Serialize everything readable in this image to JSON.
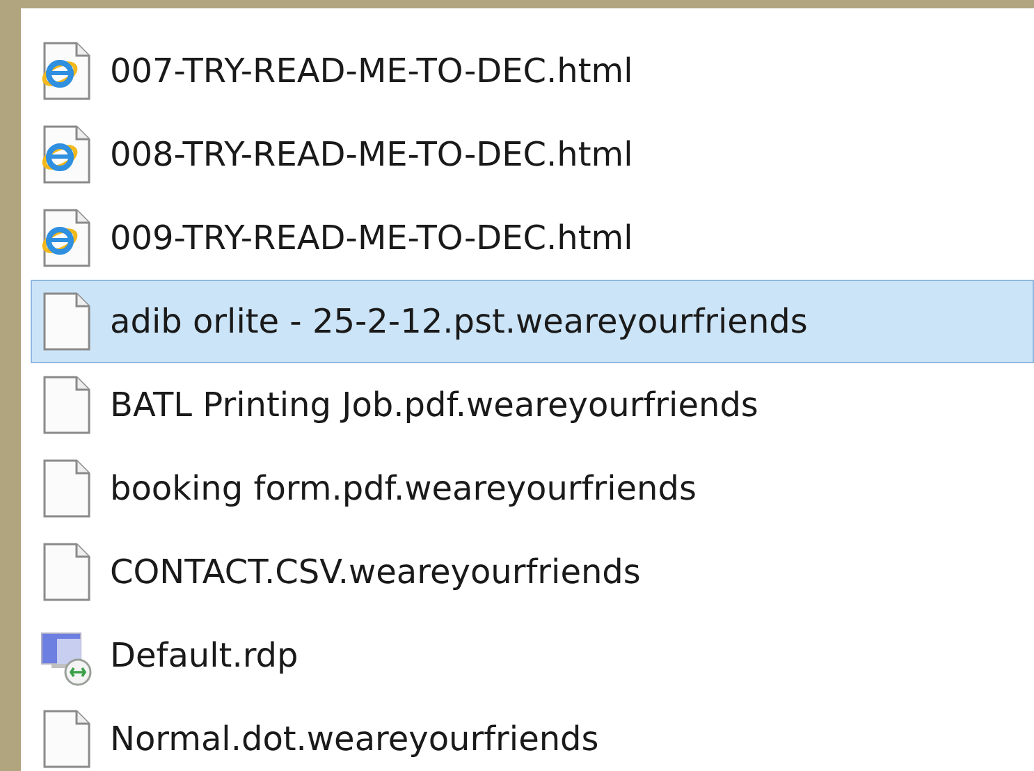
{
  "files": [
    {
      "name": "007-TRY-READ-ME-TO-DEC.html",
      "kind": "html",
      "selected": false
    },
    {
      "name": "008-TRY-READ-ME-TO-DEC.html",
      "kind": "html",
      "selected": false
    },
    {
      "name": "009-TRY-READ-ME-TO-DEC.html",
      "kind": "html",
      "selected": false
    },
    {
      "name": "adib orlite - 25-2-12.pst.weareyourfriends",
      "kind": "blank",
      "selected": true
    },
    {
      "name": "BATL Printing Job.pdf.weareyourfriends",
      "kind": "blank",
      "selected": false
    },
    {
      "name": "booking form.pdf.weareyourfriends",
      "kind": "blank",
      "selected": false
    },
    {
      "name": "CONTACT.CSV.weareyourfriends",
      "kind": "blank",
      "selected": false
    },
    {
      "name": "Default.rdp",
      "kind": "rdp",
      "selected": false
    },
    {
      "name": "Normal.dot.weareyourfriends",
      "kind": "blank",
      "selected": false
    }
  ]
}
